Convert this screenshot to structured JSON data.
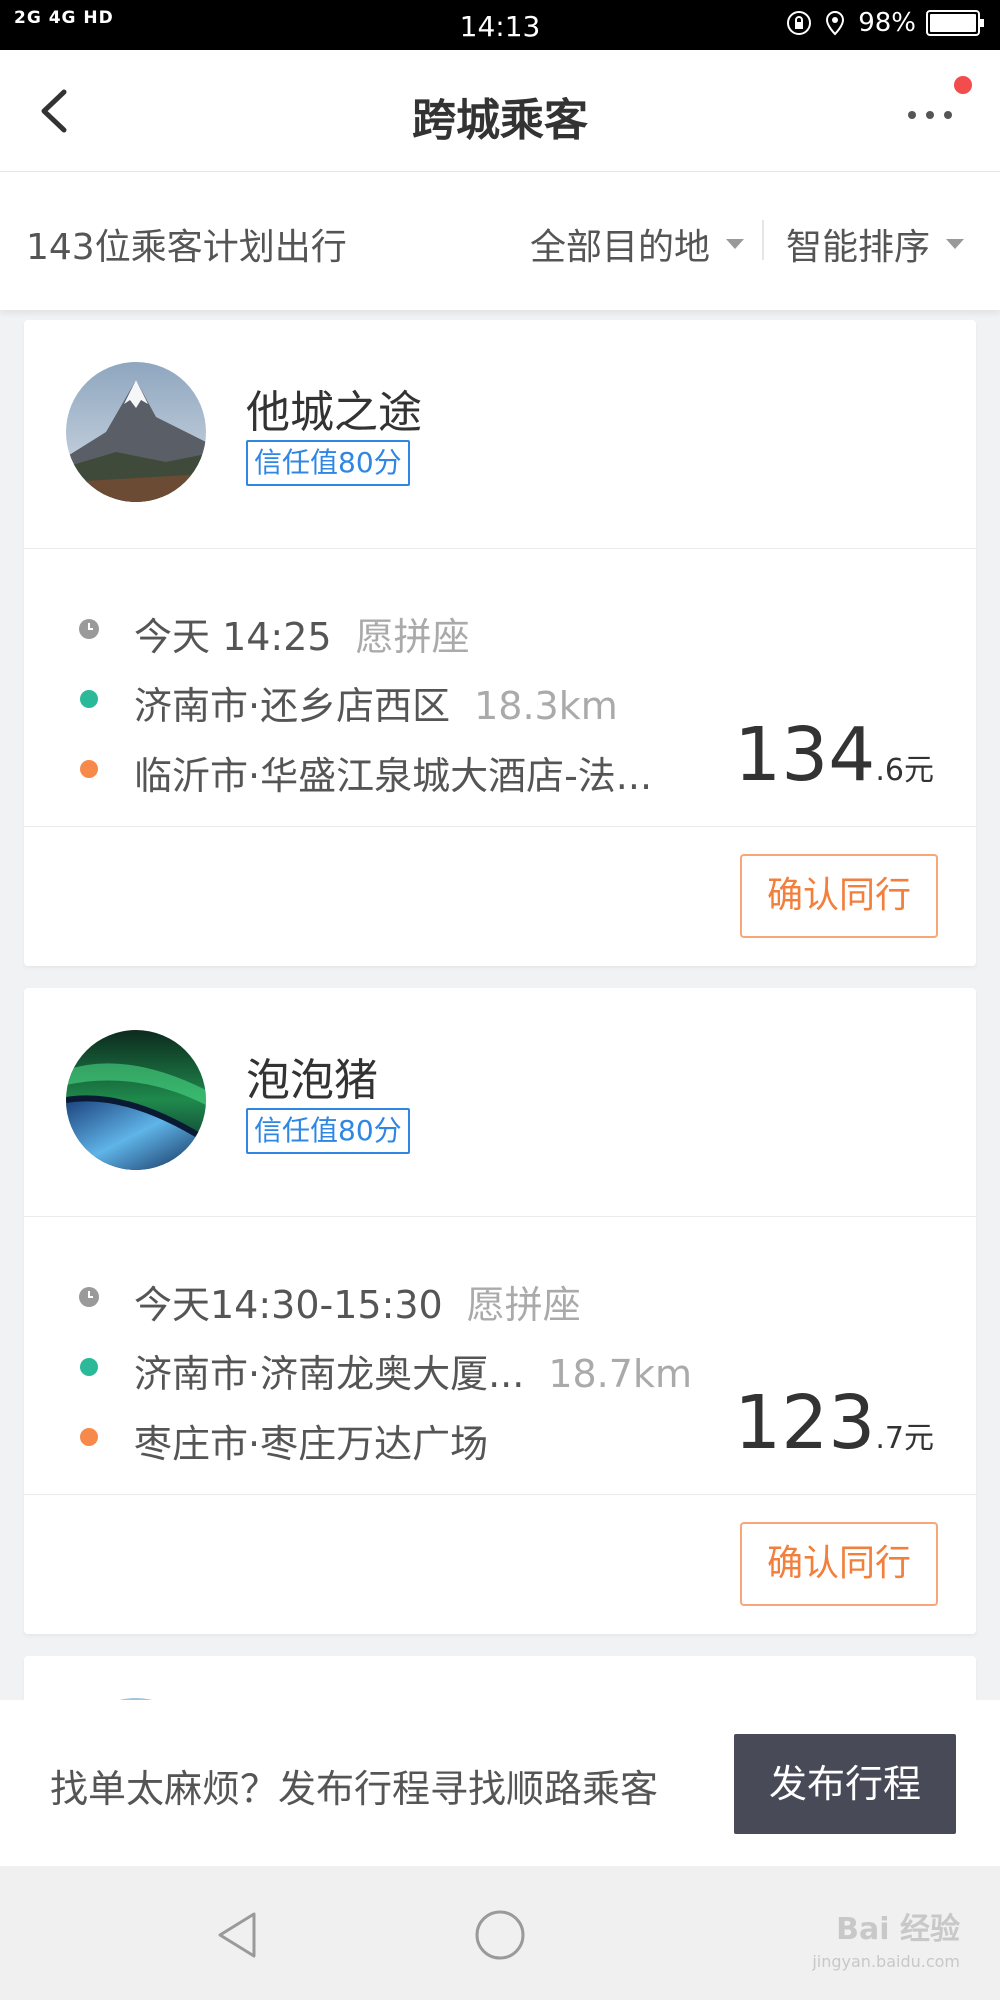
{
  "status_bar": {
    "network": "2G 4G HD",
    "time": "14:13",
    "battery": "98%"
  },
  "header": {
    "title": "跨城乘客"
  },
  "filters": {
    "count_text": "143位乘客计划出行",
    "destination": "全部目的地",
    "sort": "智能排序"
  },
  "passengers": [
    {
      "name": "他城之途",
      "trust": "信任值80分",
      "time": "今天 14:25",
      "seat": "愿拼座",
      "from": "济南市·还乡店西区",
      "distance": "18.3km",
      "to": "临沂市·华盛江泉城大酒店-法...",
      "price_int": "134",
      "price_dec": ".6元",
      "action": "确认同行"
    },
    {
      "name": "泡泡猪",
      "trust": "信任值80分",
      "time": "今天14:30-15:30",
      "seat": "愿拼座",
      "from": "济南市·济南龙奥大厦...",
      "distance": "18.7km",
      "to": "枣庄市·枣庄万达广场",
      "price_int": "123",
      "price_dec": ".7元",
      "action": "确认同行"
    }
  ],
  "promo": {
    "text": "找单太麻烦？发布行程寻找顺路乘客",
    "button": "发布行程"
  },
  "watermark": {
    "brand": "Bai 经验",
    "url": "jingyan.baidu.com"
  },
  "colors": {
    "trust_blue": "#2f86e3",
    "origin_green": "#2bb99a",
    "destination_orange": "#f7894a",
    "confirm_orange": "#f27f3c",
    "publish_bg": "#484a58",
    "badge_red": "#f24c4c"
  }
}
